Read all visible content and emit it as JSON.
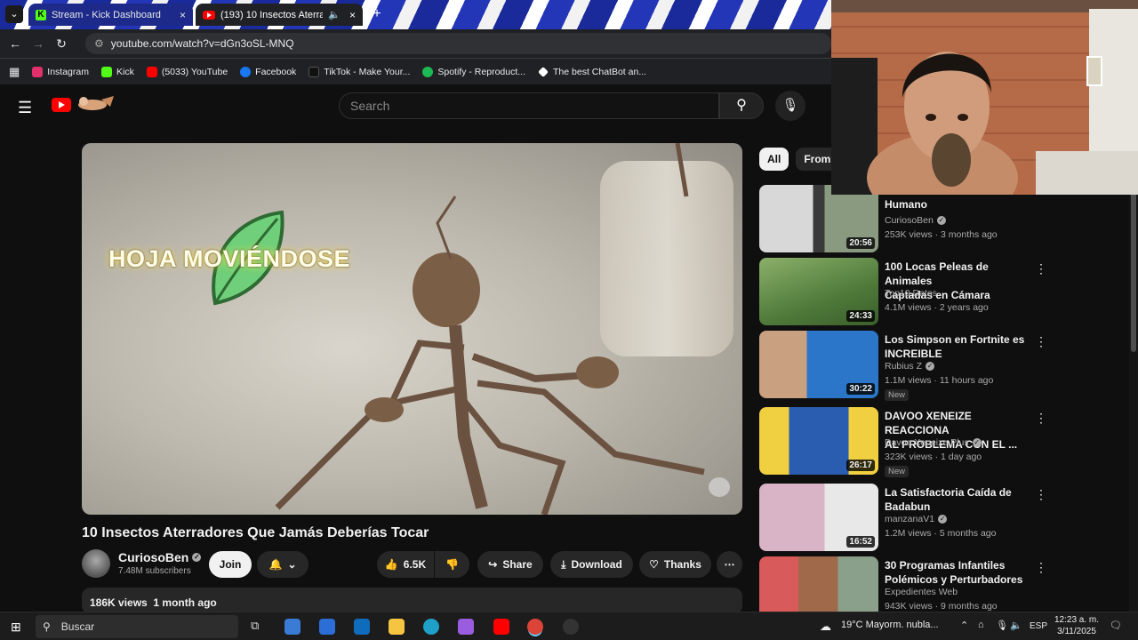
{
  "browser": {
    "tabs": [
      {
        "title": "Stream - Kick Dashboard",
        "close": "×"
      },
      {
        "title": "(193) 10 Insectos Aterrador",
        "close": "×"
      }
    ],
    "new_tab": "+",
    "url": "youtube.com/watch?v=dGn3oSL-MNQ",
    "bookmarks": [
      {
        "label": "Instagram",
        "color": "#e1306c"
      },
      {
        "label": "Kick",
        "color": "#53fc18"
      },
      {
        "label": "(5033) YouTube",
        "color": "#ff0000"
      },
      {
        "label": "Facebook",
        "color": "#1877f2"
      },
      {
        "label": "TikTok - Make Your...",
        "color": "#000000"
      },
      {
        "label": "Spotify - Reproduct...",
        "color": "#1db954"
      },
      {
        "label": "The best ChatBot an...",
        "color": "#ffffff"
      }
    ]
  },
  "youtube": {
    "search_placeholder": "Search",
    "video": {
      "overlay_text": "HOJA MOVIÉNDOSE",
      "title": "10 Insectos Aterradores Que Jamás Deberías Tocar",
      "channel": "CuriosoBen",
      "subscribers": "7.48M subscribers",
      "join": "Join",
      "likes": "6.5K",
      "share": "Share",
      "download": "Download",
      "thanks": "Thanks",
      "views": "186K views",
      "age": "1 month ago"
    },
    "chips": [
      "All",
      "From C"
    ],
    "recommendations": [
      {
        "title_lines": [
          "Humano"
        ],
        "channel": "CuriosoBen",
        "verified": true,
        "meta": "253K views · 3 months ago",
        "duration": "20:56",
        "new": "",
        "thumb": "#3a3a3a"
      },
      {
        "title_lines": [
          "100 Locas Peleas de Animales",
          "Captadas en Cámara"
        ],
        "channel": "Top10 Datos",
        "verified": false,
        "meta": "4.1M views · 2 years ago",
        "duration": "24:33",
        "new": "",
        "thumb": "#4f7a3a"
      },
      {
        "title_lines": [
          "Los Simpson en Fortnite es",
          "INCREIBLE"
        ],
        "channel": "Rubius Z",
        "verified": true,
        "meta": "1.1M views · 11 hours ago",
        "duration": "30:22",
        "new": "New",
        "thumb": "#2b76c9"
      },
      {
        "title_lines": [
          "DAVOO XENEIZE REACCIONA",
          "AL PROBLEMA CON EL ..."
        ],
        "channel": "Davoo Xeneize Plus",
        "verified": true,
        "meta": "323K views · 1 day ago",
        "duration": "26:17",
        "new": "New",
        "thumb": "#2a5db0"
      },
      {
        "title_lines": [
          "La Satisfactoria Caída de",
          "Badabun"
        ],
        "channel": "manzanaV1",
        "verified": true,
        "meta": "1.2M views · 5 months ago",
        "duration": "16:52",
        "new": "",
        "thumb": "#c9a3b8"
      },
      {
        "title_lines": [
          "30 Programas Infantiles",
          "Polémicos y Perturbadores"
        ],
        "channel": "Expedientes Web",
        "verified": false,
        "meta": "943K views · 9 months ago",
        "duration": "",
        "new": "",
        "thumb": "#b54a4a"
      }
    ]
  },
  "taskbar": {
    "search": "Buscar",
    "weather": "19°C  Mayorm. nubla...",
    "lang": "ESP",
    "time": "12:23 a. m.",
    "date": "3/11/2025"
  }
}
